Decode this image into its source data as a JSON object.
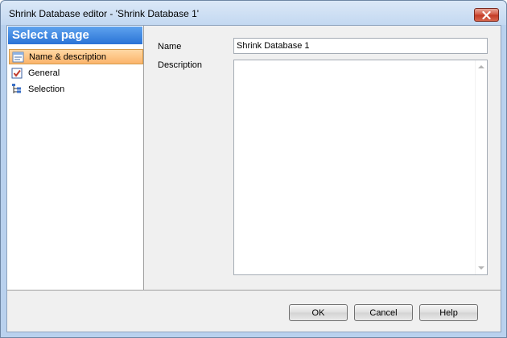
{
  "window": {
    "title": "Shrink Database editor - 'Shrink Database 1'"
  },
  "icons": {
    "close": "close-icon"
  },
  "sidebar": {
    "header": "Select a page",
    "items": [
      {
        "label": "Name & description",
        "icon": "name-description-icon",
        "selected": true
      },
      {
        "label": "General",
        "icon": "general-checkbox-icon",
        "selected": false
      },
      {
        "label": "Selection",
        "icon": "selection-tree-icon",
        "selected": false
      }
    ]
  },
  "form": {
    "name_label": "Name",
    "name_value": "Shrink Database 1",
    "description_label": "Description",
    "description_value": ""
  },
  "buttons": {
    "ok": "OK",
    "cancel": "Cancel",
    "help": "Help"
  },
  "colors": {
    "header_blue": "#2a73d6",
    "selected_orange": "#fbb46b",
    "close_red": "#c23a25"
  }
}
